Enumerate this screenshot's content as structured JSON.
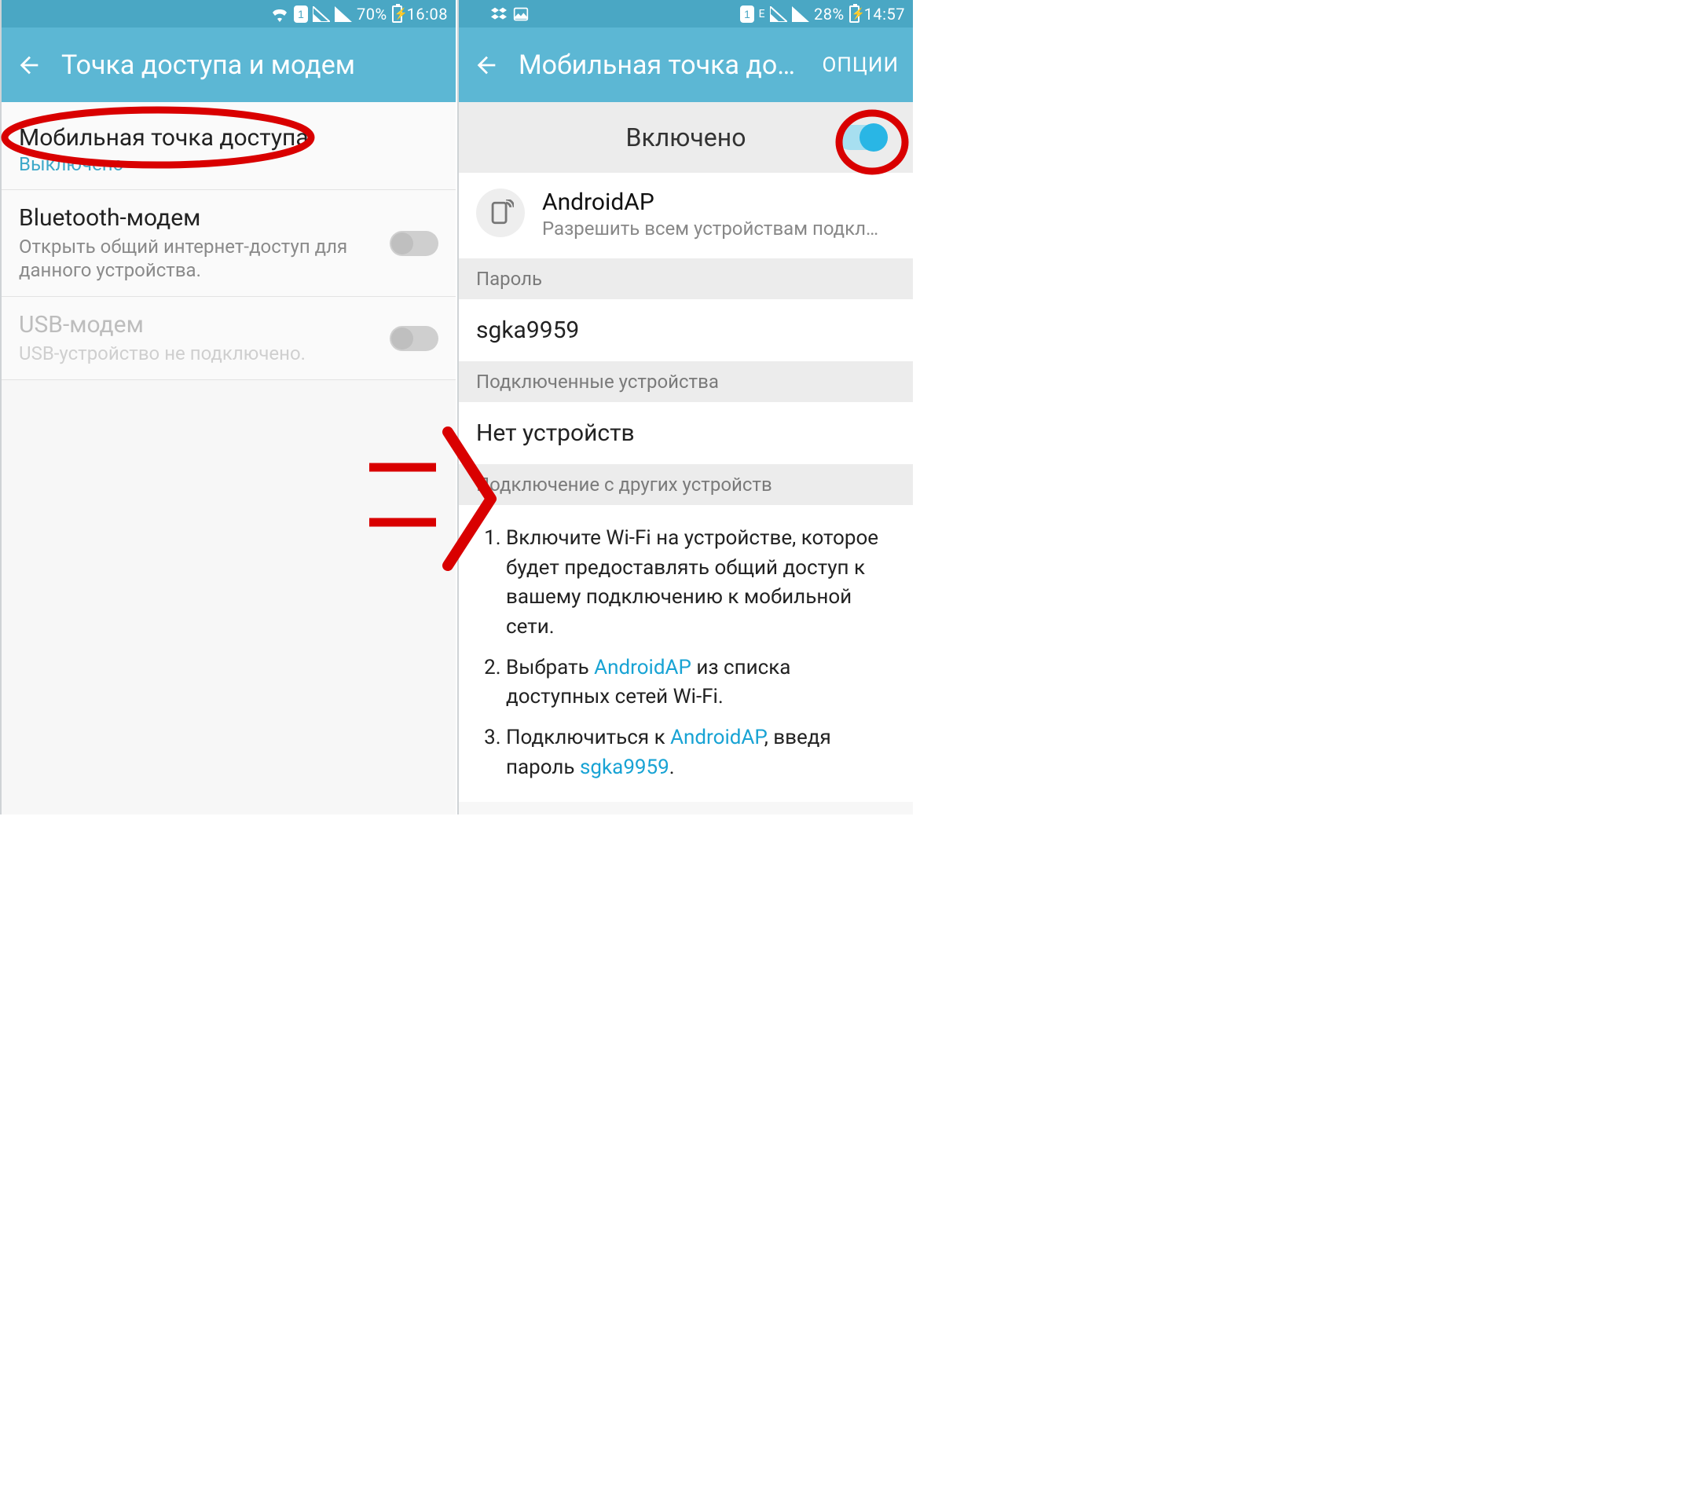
{
  "left": {
    "status": {
      "battery": "70%",
      "time": "16:08",
      "sim": "1"
    },
    "appbar": {
      "title": "Точка доступа и модем"
    },
    "rows": {
      "hotspot": {
        "title": "Мобильная точка доступа",
        "state": "Выключено"
      },
      "bluetooth": {
        "title": "Bluetooth-модем",
        "subtitle": "Открыть общий интернет-доступ для данного устройства."
      },
      "usb": {
        "title": "USB-модем",
        "subtitle": "USB-устройство не подключено."
      }
    }
  },
  "right": {
    "status": {
      "battery": "28%",
      "time": "14:57",
      "sim": "1",
      "net": "E"
    },
    "appbar": {
      "title": "Мобильная точка дост…",
      "menu": "ОПЦИИ"
    },
    "toggle": {
      "label": "Включено"
    },
    "ap": {
      "name": "AndroidAP",
      "subtitle": "Разрешить всем устройствам подключ…"
    },
    "sections": {
      "password_header": "Пароль",
      "password_value": "sgka9959",
      "connected_header": "Подключенные устройства",
      "connected_value": "Нет устройств",
      "howto_header": "Подключение с других устройств"
    },
    "instructions": {
      "step1": "Включите Wi-Fi на устройстве, которое будет предоставлять общий доступ к вашему подключению к мобильной сети.",
      "step2a": "Выбрать ",
      "step2b": " из списка доступных сетей Wi-Fi.",
      "step3a": "Подключиться к ",
      "step3b": ", введя пароль ",
      "ap": "AndroidAP",
      "pw": "sgka9959",
      "period": "."
    }
  }
}
